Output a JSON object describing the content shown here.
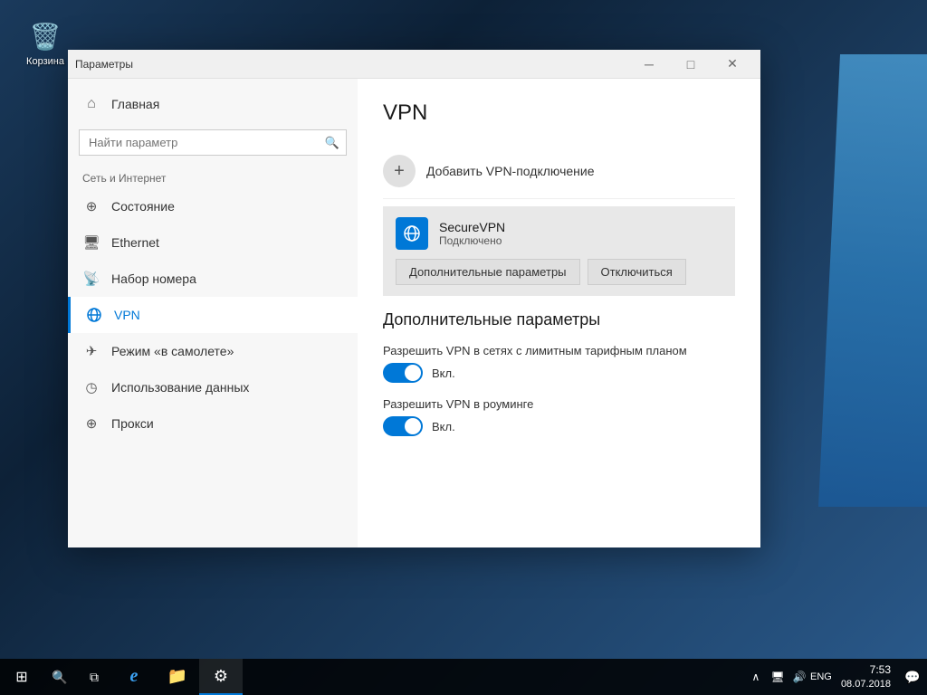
{
  "desktop": {
    "icon": {
      "label": "Корзина",
      "symbol": "🗑"
    }
  },
  "window": {
    "title": "Параметры",
    "minimize_btn": "─",
    "maximize_btn": "□",
    "close_btn": "✕"
  },
  "sidebar": {
    "home_label": "Главная",
    "search_placeholder": "Найти параметр",
    "section_label": "Сеть и Интернет",
    "nav_items": [
      {
        "id": "status",
        "label": "Состояние",
        "icon": "🌐"
      },
      {
        "id": "ethernet",
        "label": "Ethernet",
        "icon": "🖥"
      },
      {
        "id": "dial",
        "label": "Набор номера",
        "icon": "📡"
      },
      {
        "id": "vpn",
        "label": "VPN",
        "icon": "🔗",
        "active": true
      },
      {
        "id": "airplane",
        "label": "Режим «в самолете»",
        "icon": "✈"
      },
      {
        "id": "datausage",
        "label": "Использование данных",
        "icon": "📊"
      },
      {
        "id": "proxy",
        "label": "Прокси",
        "icon": "🌐"
      }
    ]
  },
  "main": {
    "page_title": "VPN",
    "add_vpn_label": "Добавить VPN-подключение",
    "vpn_connection": {
      "name": "SecureVPN",
      "status": "Подключено",
      "btn_settings": "Дополнительные параметры",
      "btn_disconnect": "Отключиться"
    },
    "additional_settings_title": "Дополнительные параметры",
    "toggles": [
      {
        "id": "metered",
        "label": "Разрешить VPN в сетях с лимитным тарифным планом",
        "value_label": "Вкл.",
        "enabled": true
      },
      {
        "id": "roaming",
        "label": "Разрешить VPN в роуминге",
        "value_label": "Вкл.",
        "enabled": true
      }
    ]
  },
  "taskbar": {
    "start_icon": "⊞",
    "search_icon": "🔍",
    "task_view_icon": "⧉",
    "apps": [
      {
        "id": "edge",
        "label": "e",
        "active": false
      },
      {
        "id": "explorer",
        "label": "📁",
        "active": false
      },
      {
        "id": "settings",
        "label": "⚙",
        "active": true
      }
    ],
    "tray": {
      "chevron": "∧",
      "network": "🖥",
      "volume": "🔊",
      "lang": "ENG"
    },
    "clock": {
      "time": "7:53",
      "date": "08.07.2018"
    },
    "notification_icon": "💬"
  }
}
